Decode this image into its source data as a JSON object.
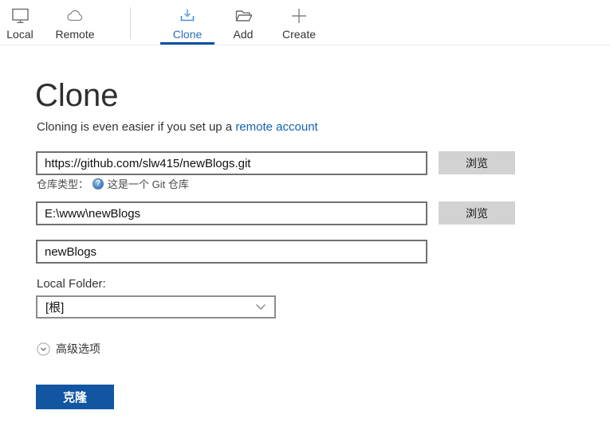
{
  "toolbar": {
    "items": [
      {
        "label": "Local",
        "icon": "monitor-icon"
      },
      {
        "label": "Remote",
        "icon": "cloud-icon"
      },
      {
        "label": "Clone",
        "icon": "download-icon",
        "active": true
      },
      {
        "label": "Add",
        "icon": "folder-open-icon"
      },
      {
        "label": "Create",
        "icon": "plus-icon"
      }
    ]
  },
  "page": {
    "title": "Clone",
    "subtitle_prefix": "Cloning is even easier if you set up a ",
    "subtitle_link": "remote account"
  },
  "form": {
    "source_url": {
      "value": "https://github.com/slw415/newBlogs.git",
      "browse_label": "浏览"
    },
    "repo_type": {
      "label": "仓库类型：",
      "status": "这是一个 Git 仓库",
      "help_glyph": "?"
    },
    "dest_path": {
      "value": "E:\\www\\newBlogs",
      "browse_label": "浏览"
    },
    "bookmark_name": {
      "value": "newBlogs"
    },
    "local_folder": {
      "label": "Local Folder:",
      "value": "[根]"
    },
    "advanced_label": "高级选项",
    "clone_button_label": "克隆"
  },
  "colors": {
    "accent_blue": "#1256a2",
    "active_tab_blue": "#2a70b8",
    "underline_blue": "#0f50a0",
    "link_blue": "#1264b3",
    "icon_blue": "#4a95d9",
    "browse_gray": "#d2d2d2",
    "input_border": "#717171"
  }
}
